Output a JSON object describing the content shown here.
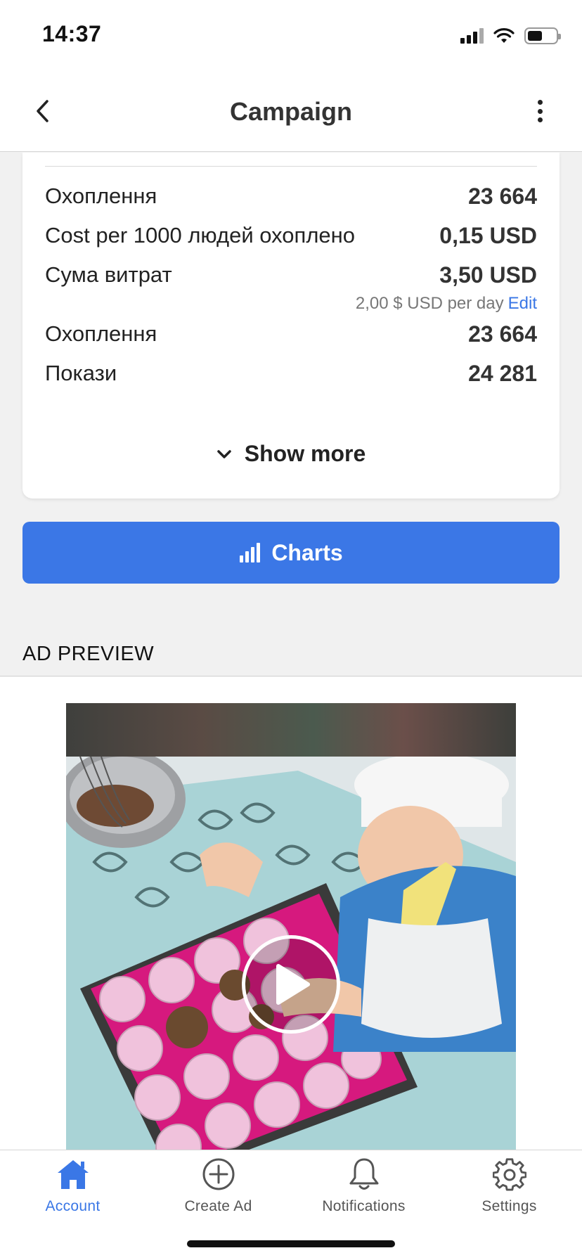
{
  "status_bar": {
    "time": "14:37"
  },
  "nav": {
    "title": "Campaign"
  },
  "stats": {
    "rows": [
      {
        "label": "Охоплення",
        "value": "23 664"
      },
      {
        "label": "Cost per 1000 людей охоплено",
        "value": "0,15 USD"
      },
      {
        "label": "Сума витрат",
        "value": "3,50 USD",
        "sub": "2,00 $ USD per day",
        "sub_link": "Edit"
      },
      {
        "label": "Охоплення",
        "value": "23 664"
      },
      {
        "label": "Покази",
        "value": "24 281"
      }
    ],
    "show_more": "Show more"
  },
  "charts_button": {
    "label": "Charts"
  },
  "ad_preview": {
    "title": "AD PREVIEW"
  },
  "tabs": [
    {
      "label": "Account",
      "icon": "home-icon",
      "active": true
    },
    {
      "label": "Create Ad",
      "icon": "plus-circle-icon",
      "active": false
    },
    {
      "label": "Notifications",
      "icon": "bell-icon",
      "active": false
    },
    {
      "label": "Settings",
      "icon": "gear-icon",
      "active": false
    }
  ],
  "colors": {
    "accent": "#3b77e6",
    "background": "#f1f1f1",
    "text": "#222222"
  }
}
